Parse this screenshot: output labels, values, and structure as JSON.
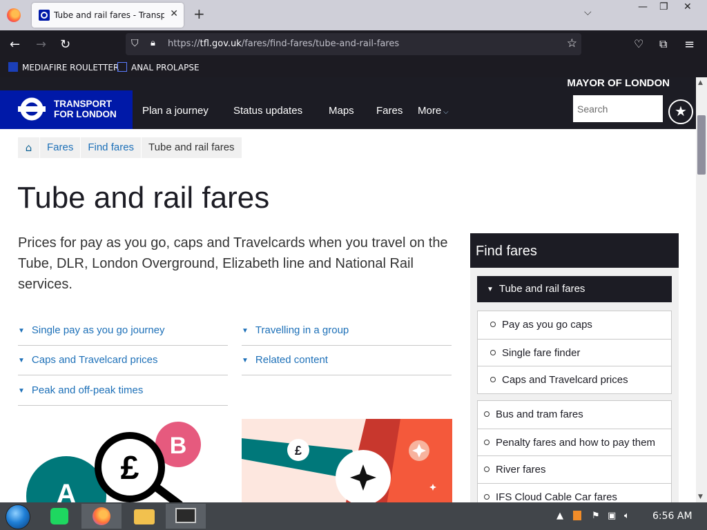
{
  "browser": {
    "tab_title": "Tube and rail fares - Transport f",
    "url_prefix": "https://",
    "url_host": "tfl.gov.uk",
    "url_path": "/fares/find-fares/tube-and-rail-fares",
    "bookmarks": [
      "MEDIAFIRE ROULETTER",
      "ANAL PROLAPSE"
    ]
  },
  "header": {
    "mayor": "MAYOR OF LONDON",
    "brand_line1": "TRANSPORT",
    "brand_line2": "FOR LONDON",
    "nav": [
      "Plan a journey",
      "Status updates",
      "Maps",
      "Fares",
      "More"
    ],
    "search_placeholder": "Search"
  },
  "breadcrumb": [
    "Fares",
    "Find fares",
    "Tube and rail fares"
  ],
  "main": {
    "title": "Tube and rail fares",
    "intro": "Prices for pay as you go, caps and Travelcards when you travel on the Tube, DLR, London Overground, Elizabeth line and National Rail services.",
    "anchors_left": [
      "Single pay as you go journey",
      "Caps and Travelcard prices",
      "Peak and off-peak times"
    ],
    "anchors_right": [
      "Travelling in a group",
      "Related content"
    ],
    "image_left_letters": [
      "B",
      "A",
      "£"
    ],
    "image_right_symbol": "£"
  },
  "sidebar": {
    "heading": "Find fares",
    "active": "Tube and rail fares",
    "subitems": [
      "Pay as you go caps",
      "Single fare finder",
      "Caps and Travelcard prices"
    ],
    "others": [
      "Bus and tram fares",
      "Penalty fares and how to pay them",
      "River fares",
      "IFS Cloud Cable Car fares"
    ]
  },
  "taskbar": {
    "clock": "6:56 AM"
  },
  "colors": {
    "tfl_blue": "#0019a8",
    "link_blue": "#1d70b8",
    "dark": "#1c1c24"
  }
}
